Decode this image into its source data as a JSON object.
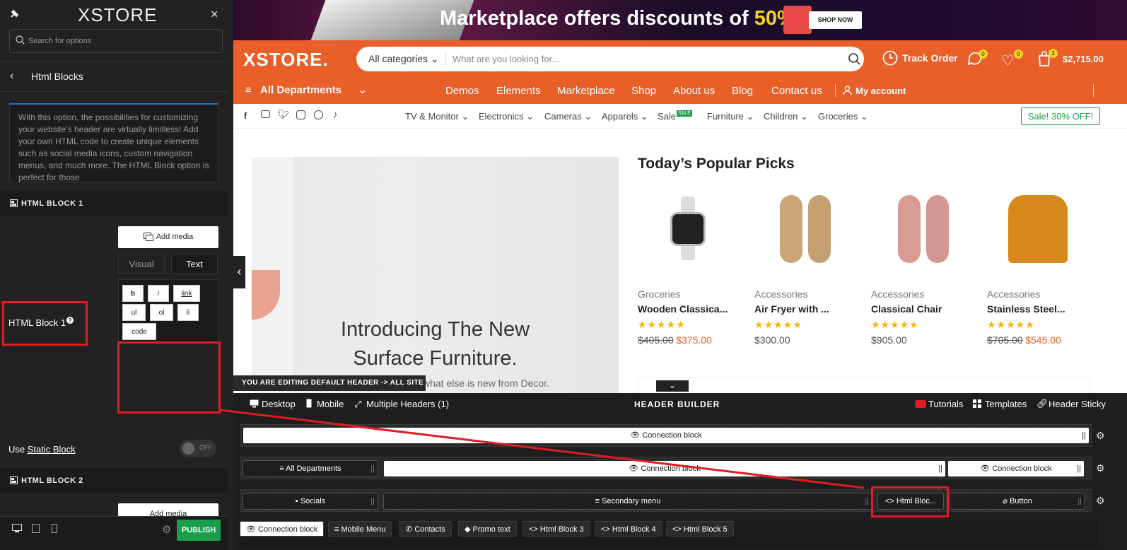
{
  "panel": {
    "logo": "XSTORE",
    "search_placeholder": "Search for options",
    "section_title": "Html Blocks",
    "description": "With this option, the possibilities for customizing your website's header are virtually limitless! Add your own HTML code to create unique elements such as social media icons, custom navigation menus, and much more. The HTML Block option is perfect for those",
    "block1_title": "HTML BLOCK 1",
    "add_media": "Add media",
    "tab_visual": "Visual",
    "tab_text": "Text",
    "quicktags": [
      "b",
      "i",
      "link",
      "ul",
      "ol",
      "li",
      "code"
    ],
    "field_label": "HTML Block 1",
    "use_label": "Use ",
    "static_block_link": "Static Block",
    "toggle_off": "OFF",
    "block2_title": "HTML BLOCK 2",
    "publish": "PUBLISH"
  },
  "banner": {
    "text": "Marketplace offers discounts of ",
    "percent": "50%",
    "shop_now": "SHOP NOW"
  },
  "header": {
    "logo": "XSTORE.",
    "category_select": "All categories",
    "search_placeholder": "What are you looking for...",
    "track_order": "Track Order",
    "compare_count": "0",
    "wishlist_count": "0",
    "cart_count": "3",
    "cart_total": "$2,715.00",
    "all_departments": "All Departments",
    "nav": [
      "Demos",
      "Elements",
      "Marketplace",
      "Shop",
      "About us",
      "Blog",
      "Contact us"
    ],
    "my_account": "My account",
    "subnav": [
      "TV & Monitor",
      "Electronics",
      "Cameras",
      "Apparels",
      "Sale",
      "Furniture",
      "Children",
      "Groceries"
    ],
    "sale_badge": "SALE",
    "sale_promo": "Sale! 30% OFF!"
  },
  "hero": {
    "title_line1": "Introducing The New",
    "title_line2": "Surface Furniture.",
    "subtitle": "what else is new from Decor."
  },
  "popular": {
    "title": "Today’s Popular Picks",
    "products": [
      {
        "category": "Groceries",
        "name": "Wooden Classica...",
        "old_price": "$405.00",
        "price": "$375.00",
        "stars": "★★★★★"
      },
      {
        "category": "Accessories",
        "name": "Air Fryer with ...",
        "old_price": "",
        "price": "$300.00",
        "stars": "★★★★★"
      },
      {
        "category": "Accessories",
        "name": "Classical Chair",
        "old_price": "",
        "price": "$905.00",
        "stars": "★★★★★"
      },
      {
        "category": "Accessories",
        "name": "Stainless Steel...",
        "old_price": "$705.00",
        "price": "$545.00",
        "stars": "★★★★★"
      }
    ]
  },
  "builder": {
    "editing_notice": "YOU ARE EDITING DEFAULT HEADER -> ALL SITE",
    "desktop": "Desktop",
    "mobile": "Mobile",
    "multiple_headers": "Multiple Headers (1)",
    "title": "HEADER BUILDER",
    "tutorials": "Tutorials",
    "templates": "Templates",
    "header_sticky": "Header Sticky",
    "row1": [
      "Connection block"
    ],
    "row2": [
      "All Departments",
      "Connection block",
      "Connection block"
    ],
    "row3": [
      "Socials",
      "Secondary menu",
      "Html Bloc...",
      "Button"
    ],
    "chips": [
      "Connection block",
      "Mobile Menu",
      "Contacts",
      "Promo text",
      "Html Block 3",
      "Html Block 4",
      "Html Block 5"
    ]
  },
  "colors": {
    "accent": "#e85f2a",
    "publish": "#1a9e4b",
    "highlight": "#e01c24"
  }
}
